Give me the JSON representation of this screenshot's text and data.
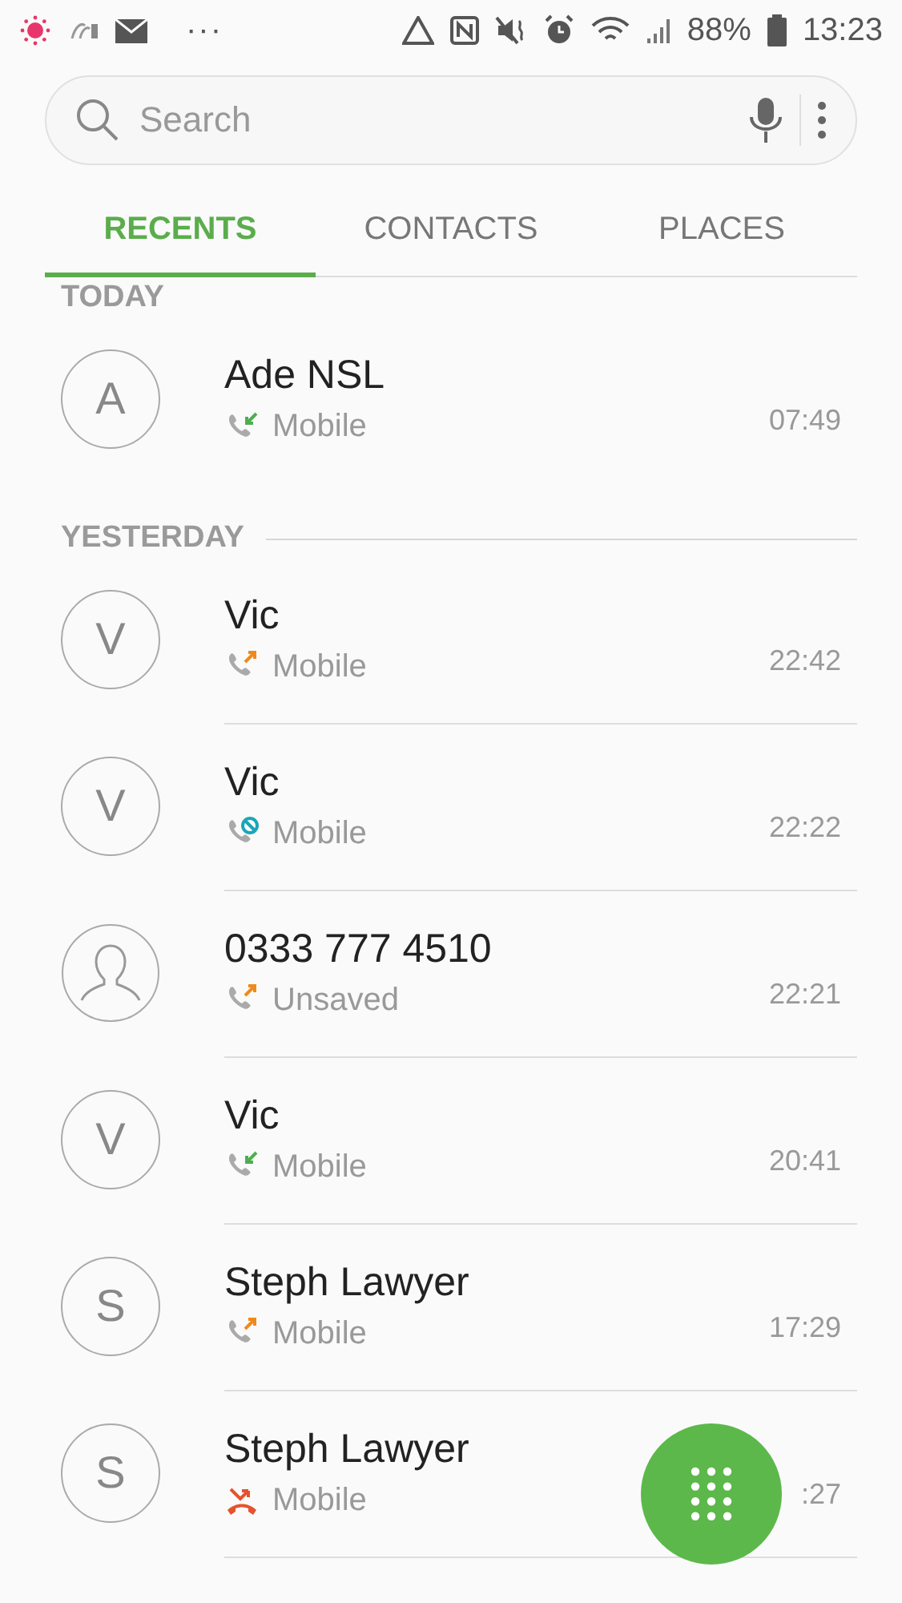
{
  "status_bar": {
    "battery": "88%",
    "time": "13:23",
    "overflow": "···"
  },
  "search": {
    "placeholder": "Search"
  },
  "tabs": [
    {
      "label": "RECENTS",
      "selected": true
    },
    {
      "label": "CONTACTS",
      "selected": false
    },
    {
      "label": "PLACES",
      "selected": false
    }
  ],
  "sections": [
    {
      "header": "TODAY",
      "calls": [
        {
          "avatar": "A",
          "kind": "incoming",
          "name": "Ade NSL",
          "type": "Mobile",
          "time": "07:49"
        }
      ]
    },
    {
      "header": "YESTERDAY",
      "calls": [
        {
          "avatar": "V",
          "kind": "outgoing",
          "name": "Vic",
          "type": "Mobile",
          "time": "22:42"
        },
        {
          "avatar": "V",
          "kind": "blocked",
          "name": "Vic",
          "type": "Mobile",
          "time": "22:22"
        },
        {
          "kind": "outgoing",
          "name": "0333 777 4510",
          "type": "Unsaved",
          "time": "22:21"
        },
        {
          "avatar": "V",
          "kind": "incoming",
          "name": "Vic",
          "type": "Mobile",
          "time": "20:41"
        },
        {
          "avatar": "S",
          "kind": "outgoing",
          "name": "Steph Lawyer",
          "type": "Mobile",
          "time": "17:29"
        },
        {
          "avatar": "S",
          "kind": "rejected",
          "name": "Steph Lawyer",
          "type": "Mobile",
          "time": ":27"
        }
      ]
    }
  ]
}
